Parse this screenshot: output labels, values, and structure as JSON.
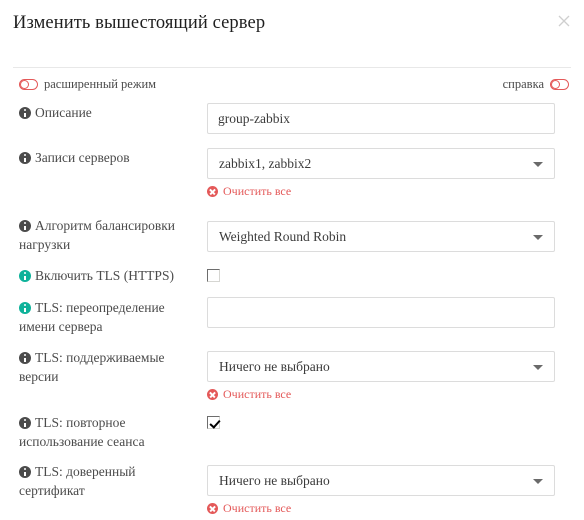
{
  "dialog": {
    "title": "Изменить вышестоящий сервер",
    "close_icon": "close-icon"
  },
  "toolbar": {
    "advanced_mode_label": "расширенный режим",
    "advanced_mode_state": "off",
    "help_label": "справка",
    "help_state": "off"
  },
  "colors": {
    "accent_red": "#e45959",
    "teal": "#0eb29a",
    "label_gray": "#4b4b4b",
    "border_gray": "#dcdcdc"
  },
  "clear_all_label": "Очистить все",
  "fields": [
    {
      "id": "description",
      "label": "Описание",
      "icon": "info-icon",
      "icon_color": "gray",
      "control": "text",
      "value": "group-zabbix",
      "placeholder": ""
    },
    {
      "id": "server-records",
      "label": "Записи серверов",
      "icon": "info-icon",
      "icon_color": "gray",
      "control": "select",
      "value": "zabbix1, zabbix2",
      "clear_all": true
    },
    {
      "id": "load-balancing-algorithm",
      "label": "Алгоритм балансировки нагрузки",
      "icon": "info-icon",
      "icon_color": "gray",
      "control": "select",
      "value": "Weighted Round Robin",
      "clear_all": false
    },
    {
      "id": "enable-tls",
      "label": "Включить TLS (HTTPS)",
      "icon": "info-icon",
      "icon_color": "teal",
      "control": "checkbox",
      "checked": false
    },
    {
      "id": "tls-server-name-override",
      "label": "TLS: переопределение имени сервера",
      "icon": "info-icon",
      "icon_color": "teal",
      "control": "text",
      "value": "",
      "placeholder": ""
    },
    {
      "id": "tls-supported-versions",
      "label": "TLS: поддерживаемые версии",
      "icon": "info-icon",
      "icon_color": "gray",
      "control": "select",
      "value": "Ничего не выбрано",
      "clear_all": true
    },
    {
      "id": "tls-session-reuse",
      "label": "TLS: повторное использование сеанса",
      "icon": "info-icon",
      "icon_color": "gray",
      "control": "checkbox",
      "checked": true
    },
    {
      "id": "tls-trusted-certificate",
      "label": "TLS: доверенный сертификат",
      "icon": "info-icon",
      "icon_color": "gray",
      "control": "select",
      "value": "Ничего не выбрано",
      "clear_all": true
    }
  ]
}
